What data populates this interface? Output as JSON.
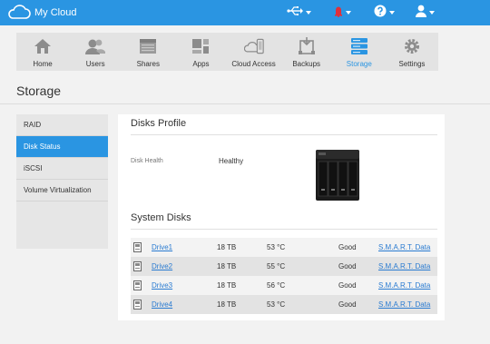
{
  "app": {
    "title": "My Cloud"
  },
  "topbar": {
    "icons": [
      "usb-icon",
      "alert-icon",
      "help-icon",
      "user-icon"
    ]
  },
  "nav": {
    "items": [
      {
        "label": "Home",
        "icon": "home-icon"
      },
      {
        "label": "Users",
        "icon": "users-icon"
      },
      {
        "label": "Shares",
        "icon": "shares-icon"
      },
      {
        "label": "Apps",
        "icon": "apps-icon"
      },
      {
        "label": "Cloud Access",
        "icon": "cloud-access-icon"
      },
      {
        "label": "Backups",
        "icon": "backups-icon"
      },
      {
        "label": "Storage",
        "icon": "storage-icon",
        "active": true
      },
      {
        "label": "Settings",
        "icon": "gear-icon"
      }
    ]
  },
  "page": {
    "title": "Storage"
  },
  "sidebar": {
    "items": [
      {
        "label": "RAID"
      },
      {
        "label": "Disk Status",
        "active": true
      },
      {
        "label": "iSCSI"
      },
      {
        "label": "Volume Virtualization"
      }
    ]
  },
  "disks_profile": {
    "title": "Disks Profile",
    "health_label": "Disk Health",
    "health_value": "Healthy"
  },
  "system_disks": {
    "title": "System Disks",
    "rows": [
      {
        "name": "Drive1",
        "size": "18 TB",
        "temp": "53 °C",
        "status": "Good",
        "smart": "S.M.A.R.T. Data"
      },
      {
        "name": "Drive2",
        "size": "18 TB",
        "temp": "55 °C",
        "status": "Good",
        "smart": "S.M.A.R.T. Data"
      },
      {
        "name": "Drive3",
        "size": "18 TB",
        "temp": "56 °C",
        "status": "Good",
        "smart": "S.M.A.R.T. Data"
      },
      {
        "name": "Drive4",
        "size": "18 TB",
        "temp": "53 °C",
        "status": "Good",
        "smart": "S.M.A.R.T. Data"
      }
    ]
  },
  "colors": {
    "accent": "#2a95e2",
    "link": "#2a7bd1",
    "alert": "#e0303a"
  }
}
